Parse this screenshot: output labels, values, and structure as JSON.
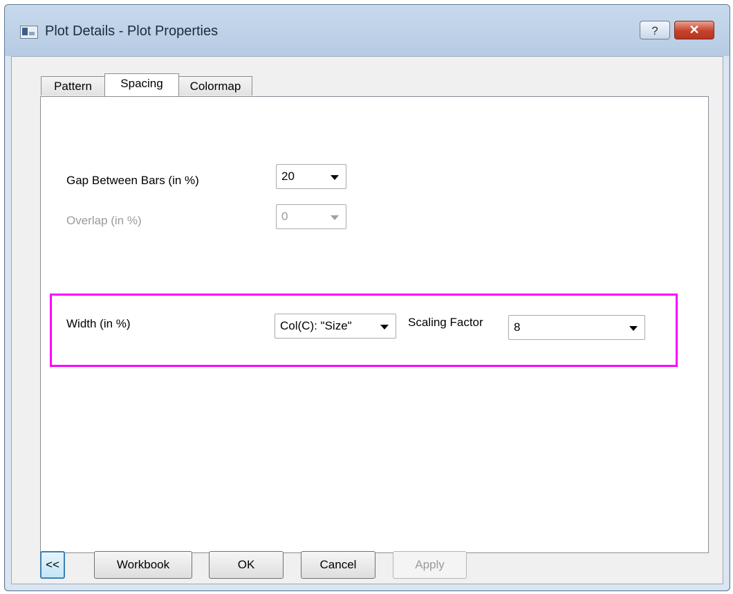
{
  "window": {
    "title": "Plot Details - Plot Properties",
    "help_label": "?",
    "close_label": "✕"
  },
  "tabs": [
    {
      "label": "Pattern",
      "active": false
    },
    {
      "label": "Spacing",
      "active": true
    },
    {
      "label": "Colormap",
      "active": false
    }
  ],
  "spacing": {
    "gap": {
      "label": "Gap Between Bars (in %)",
      "value": "20"
    },
    "overlap": {
      "label": "Overlap (in %)",
      "value": "0",
      "enabled": false
    },
    "width": {
      "label": "Width (in %)",
      "column_value": "Col(C): \"Size\"",
      "scaling_label": "Scaling Factor",
      "scaling_value": "8"
    }
  },
  "buttons": {
    "collapse": "<<",
    "workbook": "Workbook",
    "ok": "OK",
    "cancel": "Cancel",
    "apply": "Apply"
  },
  "colors": {
    "highlight": "#ff00ff",
    "close_button": "#c6412a"
  }
}
